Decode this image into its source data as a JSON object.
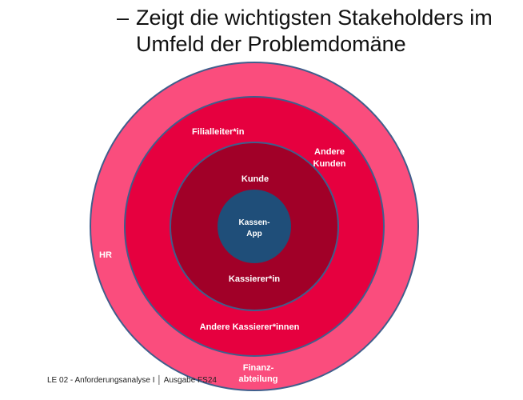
{
  "heading": {
    "bullet": "–",
    "line1": "Zeigt die wichtigsten Stakeholders im",
    "line2": "Umfeld der Problemdomäne"
  },
  "rings": {
    "outer": {
      "color": "#fa4d7d",
      "labels": {
        "hr": "HR",
        "finanz_line1": "Finanz-",
        "finanz_line2": "abteilung"
      }
    },
    "second": {
      "color": "#e6003f",
      "labels": {
        "filialleiter": "Filialleiter*in",
        "andere_kunden_line1": "Andere",
        "andere_kunden_line2": "Kunden",
        "andere_kassierer": "Andere Kassierer*innen"
      }
    },
    "third": {
      "color": "#a10028",
      "labels": {
        "kunde": "Kunde",
        "kassierer": "Kassierer*in"
      }
    },
    "center": {
      "color": "#1f4e79",
      "labels": {
        "line1": "Kassen-",
        "line2": "App"
      }
    },
    "ring_border_color": "#3f5e8c"
  },
  "footer": {
    "text": "LE 02 - Anforderungsanalyse I │ Ausgabe FS24"
  }
}
